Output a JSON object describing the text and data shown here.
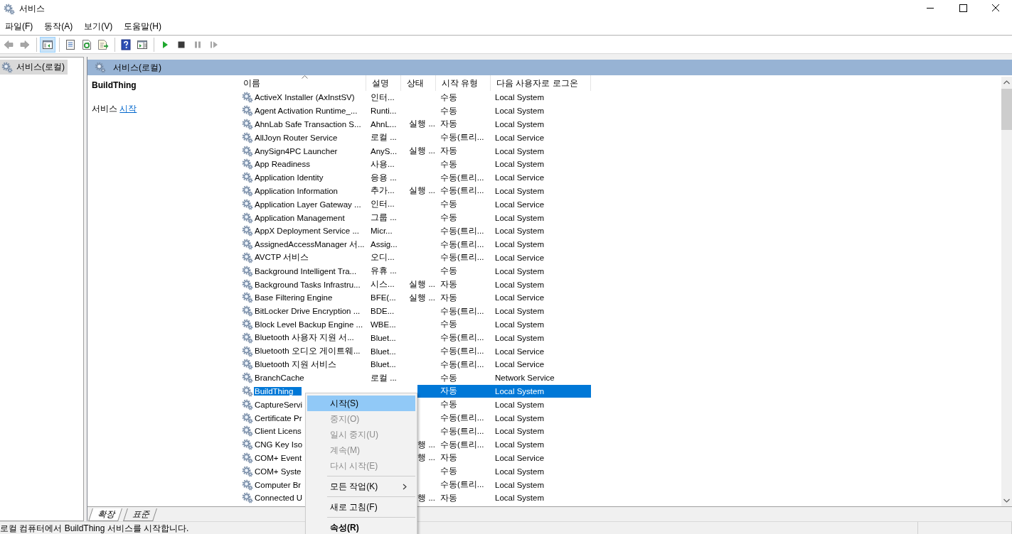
{
  "window": {
    "title": "서비스"
  },
  "menu_bar": [
    {
      "label": "파일(F)"
    },
    {
      "label": "동작(A)"
    },
    {
      "label": "보기(V)"
    },
    {
      "label": "도움말(H)"
    }
  ],
  "toolbar": [
    [
      {
        "kind": "back",
        "disabled": true,
        "pressed": false
      },
      {
        "kind": "forward",
        "disabled": true,
        "pressed": false
      }
    ],
    [
      {
        "kind": "console_tree",
        "disabled": false,
        "pressed": true
      }
    ],
    [
      {
        "kind": "properties",
        "disabled": false,
        "pressed": false
      },
      {
        "kind": "refresh",
        "disabled": false,
        "pressed": false
      },
      {
        "kind": "export",
        "disabled": false,
        "pressed": false
      }
    ],
    [
      {
        "kind": "help",
        "disabled": false,
        "pressed": false
      },
      {
        "kind": "action_pane",
        "disabled": false,
        "pressed": false
      }
    ],
    [
      {
        "kind": "start",
        "disabled": false,
        "pressed": false
      },
      {
        "kind": "stop",
        "disabled": false,
        "pressed": false
      },
      {
        "kind": "pause",
        "disabled": true,
        "pressed": false
      },
      {
        "kind": "resume",
        "disabled": true,
        "pressed": false
      }
    ]
  ],
  "tree": {
    "items": [
      {
        "label": "서비스(로컬)",
        "selected": true
      }
    ]
  },
  "detail": {
    "header": "서비스(로컬)",
    "service_name": "BuildThing",
    "action_text": "서비스",
    "action_link": "시작"
  },
  "table": {
    "columns": [
      {
        "label": "이름",
        "sorted": true
      },
      {
        "label": "설명",
        "sorted": false
      },
      {
        "label": "상태",
        "sorted": false
      },
      {
        "label": "시작 유형",
        "sorted": false
      },
      {
        "label": "다음 사용자로 로그온",
        "sorted": false
      }
    ],
    "rows": [
      {
        "name": "ActiveX Installer (AxInstSV)",
        "description": "인터...",
        "startup": "수동",
        "logon": "Local System",
        "selected": false
      },
      {
        "name": "Agent Activation Runtime_...",
        "description": "Runti...",
        "startup": "수동",
        "logon": "Local System",
        "selected": false
      },
      {
        "name": "AhnLab Safe Transaction S...",
        "description": "AhnL...",
        "status": "실행 ...",
        "startup": "자동",
        "logon": "Local System",
        "selected": false
      },
      {
        "name": "AllJoyn Router Service",
        "description": "로컬 ...",
        "startup": "수동(트리...",
        "logon": "Local Service",
        "selected": false
      },
      {
        "name": "AnySign4PC Launcher",
        "description": "AnyS...",
        "status": "실행 ...",
        "startup": "자동",
        "logon": "Local System",
        "selected": false
      },
      {
        "name": "App Readiness",
        "description": "사용...",
        "startup": "수동",
        "logon": "Local System",
        "selected": false
      },
      {
        "name": "Application Identity",
        "description": "응용 ...",
        "startup": "수동(트리...",
        "logon": "Local Service",
        "selected": false
      },
      {
        "name": "Application Information",
        "description": "추가...",
        "status": "실행 ...",
        "startup": "수동(트리...",
        "logon": "Local System",
        "selected": false
      },
      {
        "name": "Application Layer Gateway ...",
        "description": "인터...",
        "startup": "수동",
        "logon": "Local Service",
        "selected": false
      },
      {
        "name": "Application Management",
        "description": "그룹 ...",
        "startup": "수동",
        "logon": "Local System",
        "selected": false
      },
      {
        "name": "AppX Deployment Service ...",
        "description": "Micr...",
        "startup": "수동(트리...",
        "logon": "Local System",
        "selected": false
      },
      {
        "name": "AssignedAccessManager 서...",
        "description": "Assig...",
        "startup": "수동(트리...",
        "logon": "Local System",
        "selected": false
      },
      {
        "name": "AVCTP 서비스",
        "description": "오디...",
        "startup": "수동(트리...",
        "logon": "Local Service",
        "selected": false
      },
      {
        "name": "Background Intelligent Tra...",
        "description": "유휴 ...",
        "startup": "수동",
        "logon": "Local System",
        "selected": false
      },
      {
        "name": "Background Tasks Infrastru...",
        "description": "시스...",
        "status": "실행 ...",
        "startup": "자동",
        "logon": "Local System",
        "selected": false
      },
      {
        "name": "Base Filtering Engine",
        "description": "BFE(...",
        "status": "실행 ...",
        "startup": "자동",
        "logon": "Local Service",
        "selected": false
      },
      {
        "name": "BitLocker Drive Encryption ...",
        "description": "BDE...",
        "startup": "수동(트리...",
        "logon": "Local System",
        "selected": false
      },
      {
        "name": "Block Level Backup Engine ...",
        "description": "WBE...",
        "startup": "수동",
        "logon": "Local System",
        "selected": false
      },
      {
        "name": "Bluetooth 사용자 지원 서...",
        "description": "Bluet...",
        "startup": "수동(트리...",
        "logon": "Local System",
        "selected": false
      },
      {
        "name": "Bluetooth 오디오 게이트웨...",
        "description": "Bluet...",
        "startup": "수동(트리...",
        "logon": "Local Service",
        "selected": false
      },
      {
        "name": "Bluetooth 지원 서비스",
        "description": "Bluet...",
        "startup": "수동(트리...",
        "logon": "Local Service",
        "selected": false
      },
      {
        "name": "BranchCache",
        "description": "로컬 ...",
        "startup": "수동",
        "logon": "Network Service",
        "selected": false
      },
      {
        "name": "BuildThing",
        "startup": "자동",
        "logon": "Local System",
        "selected": true
      },
      {
        "name": "CaptureServi",
        "startup": "수동",
        "logon": "Local System",
        "selected": false
      },
      {
        "name": "Certificate Pr",
        "startup": "수동(트리...",
        "logon": "Local System",
        "selected": false
      },
      {
        "name": "Client Licens",
        "startup": "수동(트리...",
        "logon": "Local System",
        "selected": false
      },
      {
        "name": "CNG Key Iso",
        "status": "행 ...",
        "startup": "수동(트리...",
        "logon": "Local System",
        "selected": false
      },
      {
        "name": "COM+ Event",
        "status": "행 ...",
        "startup": "자동",
        "logon": "Local Service",
        "selected": false
      },
      {
        "name": "COM+ Syste",
        "startup": "수동",
        "logon": "Local System",
        "selected": false
      },
      {
        "name": "Computer Br",
        "startup": "수동(트리...",
        "logon": "Local System",
        "selected": false
      },
      {
        "name": "Connected U",
        "status": "행 ...",
        "startup": "자동",
        "logon": "Local System",
        "selected": false
      }
    ]
  },
  "view_tabs": [
    {
      "label": "확장",
      "selected": true
    },
    {
      "label": "표준",
      "selected": false
    }
  ],
  "context_menu": {
    "items": [
      {
        "kind": "item",
        "label": "시작(S)",
        "selected": true,
        "disabled": false,
        "default": false
      },
      {
        "kind": "item",
        "label": "중지(O)",
        "selected": false,
        "disabled": true,
        "default": false
      },
      {
        "kind": "item",
        "label": "일시 중지(U)",
        "selected": false,
        "disabled": true,
        "default": false
      },
      {
        "kind": "item",
        "label": "계속(M)",
        "selected": false,
        "disabled": true,
        "default": false
      },
      {
        "kind": "item",
        "label": "다시 시작(E)",
        "selected": false,
        "disabled": true,
        "default": false
      },
      {
        "kind": "separator"
      },
      {
        "kind": "submenu",
        "label": "모든 작업(K)",
        "selected": false,
        "disabled": false,
        "default": false
      },
      {
        "kind": "separator"
      },
      {
        "kind": "item",
        "label": "새로 고침(F)",
        "selected": false,
        "disabled": false,
        "default": false
      },
      {
        "kind": "separator"
      },
      {
        "kind": "item",
        "label": "속성(R)",
        "selected": false,
        "disabled": false,
        "default": true
      }
    ]
  },
  "status_bar": {
    "text": "로컬 컴퓨터에서 BuildThing 서비스를 시작합니다."
  }
}
